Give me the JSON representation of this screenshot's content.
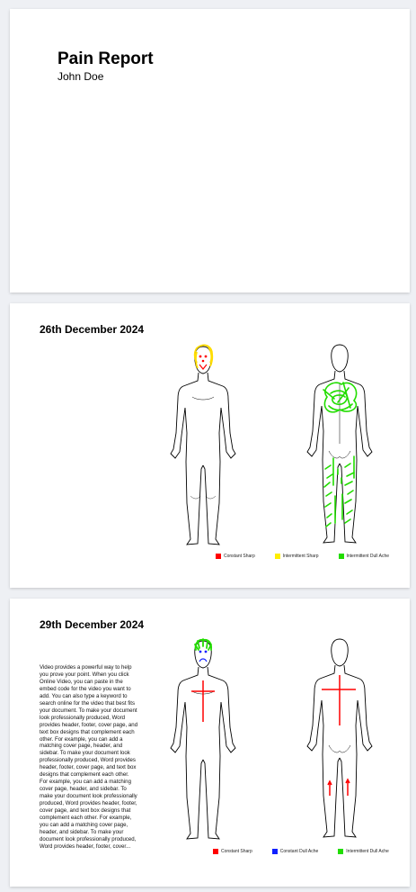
{
  "cover": {
    "title": "Pain Report",
    "author": "John Doe"
  },
  "entries": [
    {
      "date": "26th December 2024",
      "legend": [
        {
          "label": "Constant Sharp",
          "color": "#ff0000"
        },
        {
          "label": "Intermittent Sharp",
          "color": "#ffee00"
        },
        {
          "label": "Intermittent Dull Ache",
          "color": "#22dd00"
        }
      ]
    },
    {
      "date": "29th December 2024",
      "notes": "Video provides a powerful way to help you prove your point. When you click Online Video, you can paste in the embed code for the video you want to add. You can also type a keyword to search online for the video that best fits your document. To make your document look professionally produced, Word provides header, footer, cover page, and text box designs that complement each other. For example, you can add a matching cover page, header, and sidebar. To make your document look professionally produced, Word provides header, footer, cover page, and text box designs that complement each other. For example, you can add a matching cover page, header, and sidebar. To make your document look professionally produced, Word provides header, footer, cover page, and text box designs that complement each other. For example, you can add a matching cover page, header, and sidebar. To make your document look professionally produced, Word provides header, footer, cover...",
      "legend": [
        {
          "label": "Constant Sharp",
          "color": "#ff0000"
        },
        {
          "label": "Constant Dull Ache",
          "color": "#1020ff"
        },
        {
          "label": "Intermittent Dull Ache",
          "color": "#22dd00"
        }
      ]
    }
  ]
}
